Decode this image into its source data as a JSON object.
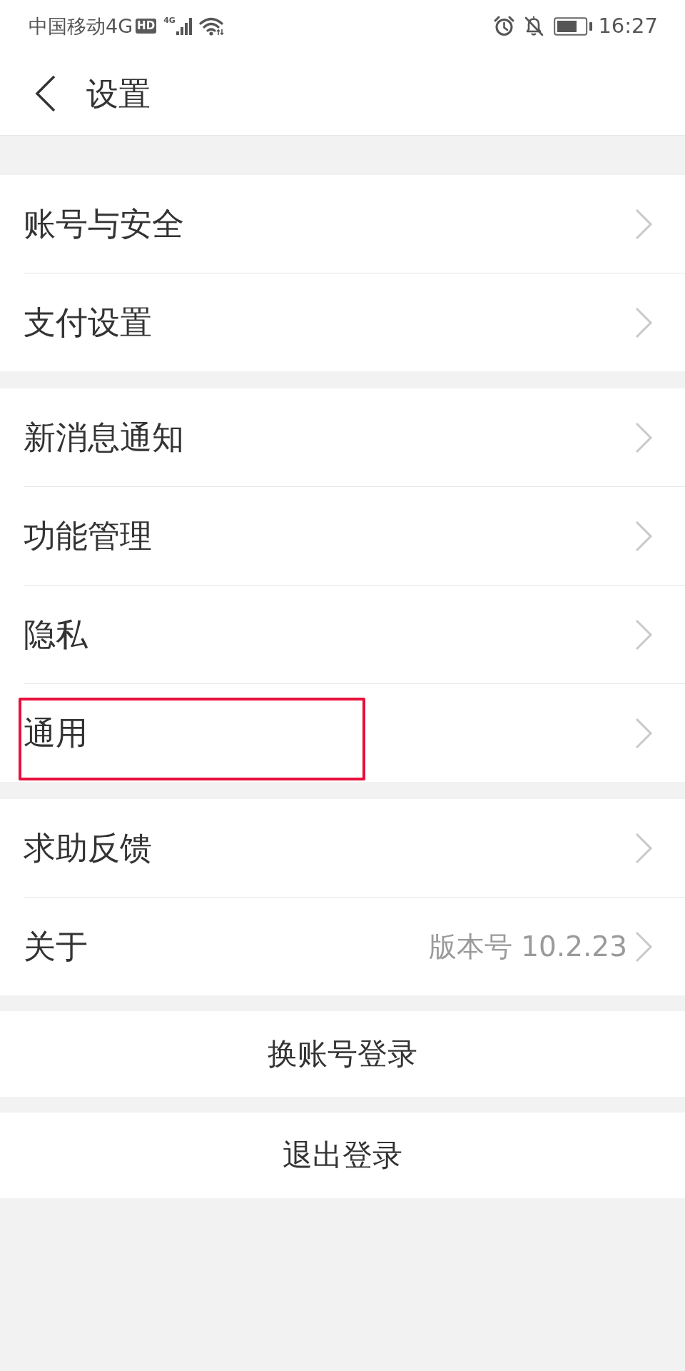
{
  "status_bar": {
    "carrier": "中国移动4G",
    "hd_badge": "HD",
    "network_type": "4G",
    "time": "16:27"
  },
  "header": {
    "title": "设置"
  },
  "sections": [
    {
      "items": [
        {
          "label": "账号与安全",
          "highlighted": false
        },
        {
          "label": "支付设置",
          "highlighted": false
        }
      ]
    },
    {
      "items": [
        {
          "label": "新消息通知",
          "highlighted": false
        },
        {
          "label": "功能管理",
          "highlighted": false
        },
        {
          "label": "隐私",
          "highlighted": false
        },
        {
          "label": "通用",
          "highlighted": true
        }
      ]
    },
    {
      "items": [
        {
          "label": "求助反馈",
          "highlighted": false
        },
        {
          "label": "关于",
          "value": "版本号 10.2.23",
          "highlighted": false
        }
      ]
    }
  ],
  "action_buttons": [
    {
      "label": "换账号登录"
    },
    {
      "label": "退出登录"
    }
  ]
}
